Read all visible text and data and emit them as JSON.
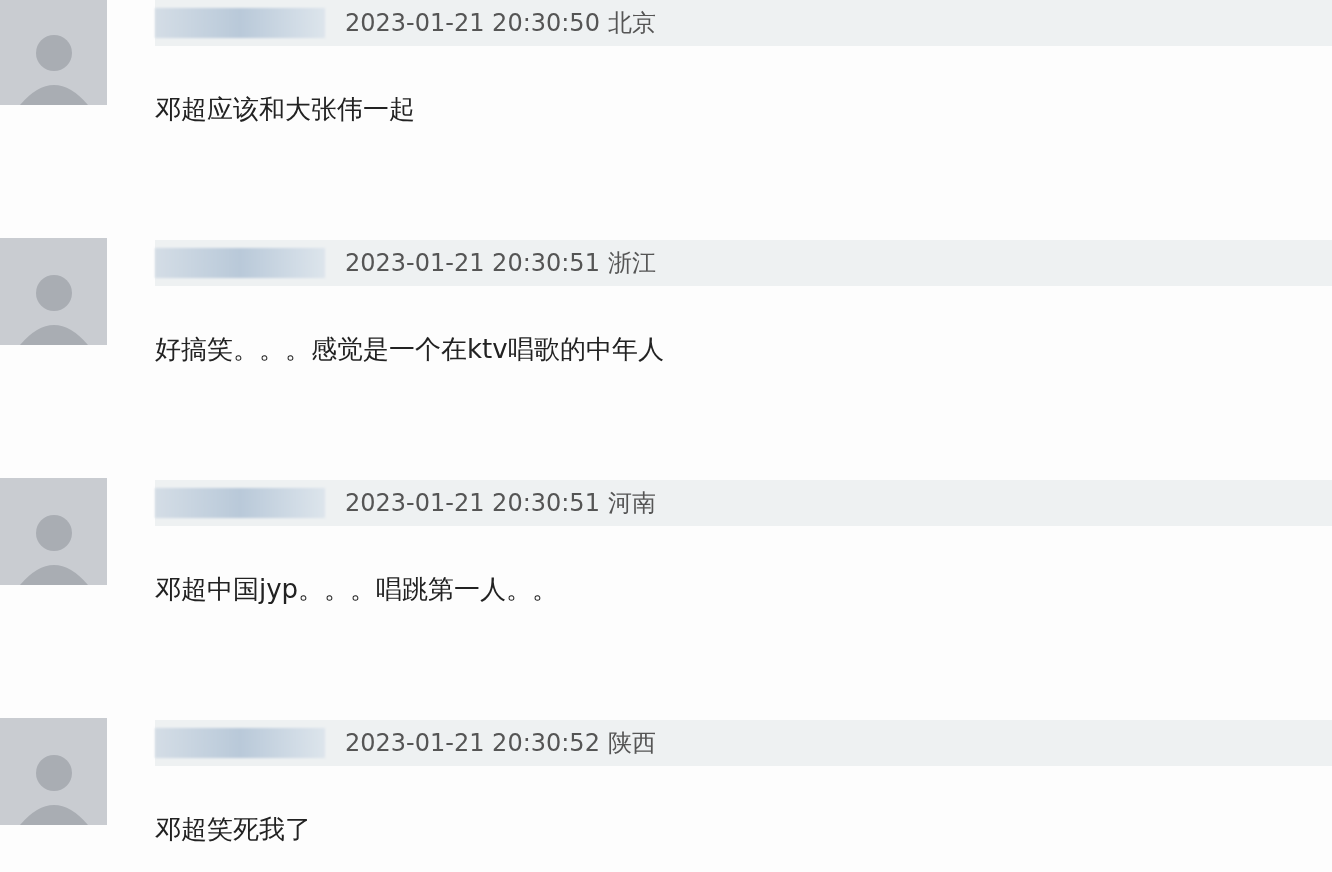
{
  "comments": [
    {
      "timestamp": "2023-01-21 20:30:50",
      "location": "北京",
      "text": "邓超应该和大张伟一起"
    },
    {
      "timestamp": "2023-01-21 20:30:51",
      "location": "浙江",
      "text": "好搞笑。。。感觉是一个在ktv唱歌的中年人"
    },
    {
      "timestamp": "2023-01-21 20:30:51",
      "location": "河南",
      "text": "邓超中国jyp。。。唱跳第一人。。"
    },
    {
      "timestamp": "2023-01-21 20:30:52",
      "location": "陕西",
      "text": "邓超笑死我了"
    }
  ]
}
